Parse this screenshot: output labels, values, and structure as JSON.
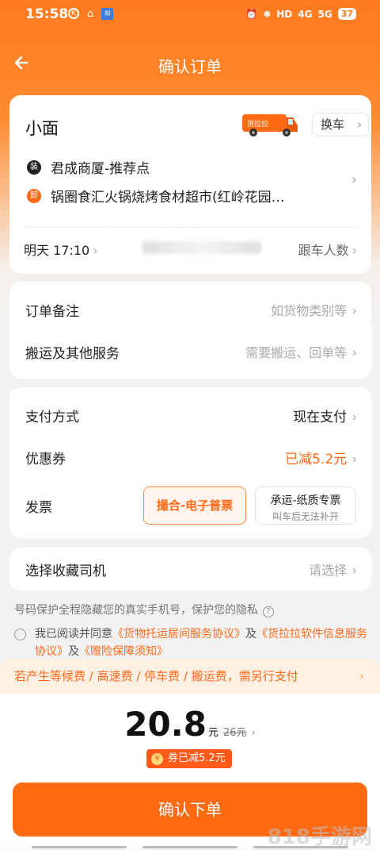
{
  "status_bar": {
    "time": "15:58",
    "signal_labels": [
      "4G",
      "5G"
    ],
    "hd_label": "HD",
    "battery": "37"
  },
  "nav": {
    "title": "确认订单"
  },
  "vehicle": {
    "type": "小面",
    "truck_text": "货拉拉",
    "swap_label": "换车"
  },
  "route": {
    "load_badge": "装",
    "load_address": "君成商厦-推荐点",
    "unload_badge": "卸",
    "unload_address": "锅圈食汇火锅烧烤食材超市(红岭花园…"
  },
  "schedule": {
    "time": "明天 17:10",
    "follow_label": "跟车人数"
  },
  "extras": [
    {
      "label": "订单备注",
      "value": "如货物类别等"
    },
    {
      "label": "搬运及其他服务",
      "value": "需要搬运、回单等"
    }
  ],
  "payment": {
    "method_label": "支付方式",
    "method_value": "现在支付",
    "coupon_label": "优惠券",
    "coupon_value": "已减5.2元",
    "invoice_label": "发票",
    "invoice_option1": "撮合-电子普票",
    "invoice_option2_title": "承运-纸质专票",
    "invoice_option2_sub": "叫车后无法补开"
  },
  "driver": {
    "label": "选择收藏司机",
    "value": "请选择"
  },
  "privacy": {
    "text": "号码保护全程隐藏您的真实手机号，保护您的隐私",
    "q": "?"
  },
  "agreement": {
    "prefix": "我已阅读并同意",
    "link1": "《货物托运居间服务协议》",
    "and1": "及",
    "link2": "《货拉拉软件信息服务协议》",
    "and2": "及",
    "link3": "《赠险保障须知》"
  },
  "notice": "若产生等候费 / 高速费 / 停车费 / 搬运费，需另行支付",
  "price": {
    "amount": "20.8",
    "unit": "元",
    "original": "26元",
    "coupon_badge": "券已减5.2元",
    "coupon_icon": "¥"
  },
  "confirm_button": "确认下单",
  "watermark": "818手游网",
  "colors": {
    "brand_orange": "#ff6a12",
    "accent_text": "#ff6a1a"
  }
}
